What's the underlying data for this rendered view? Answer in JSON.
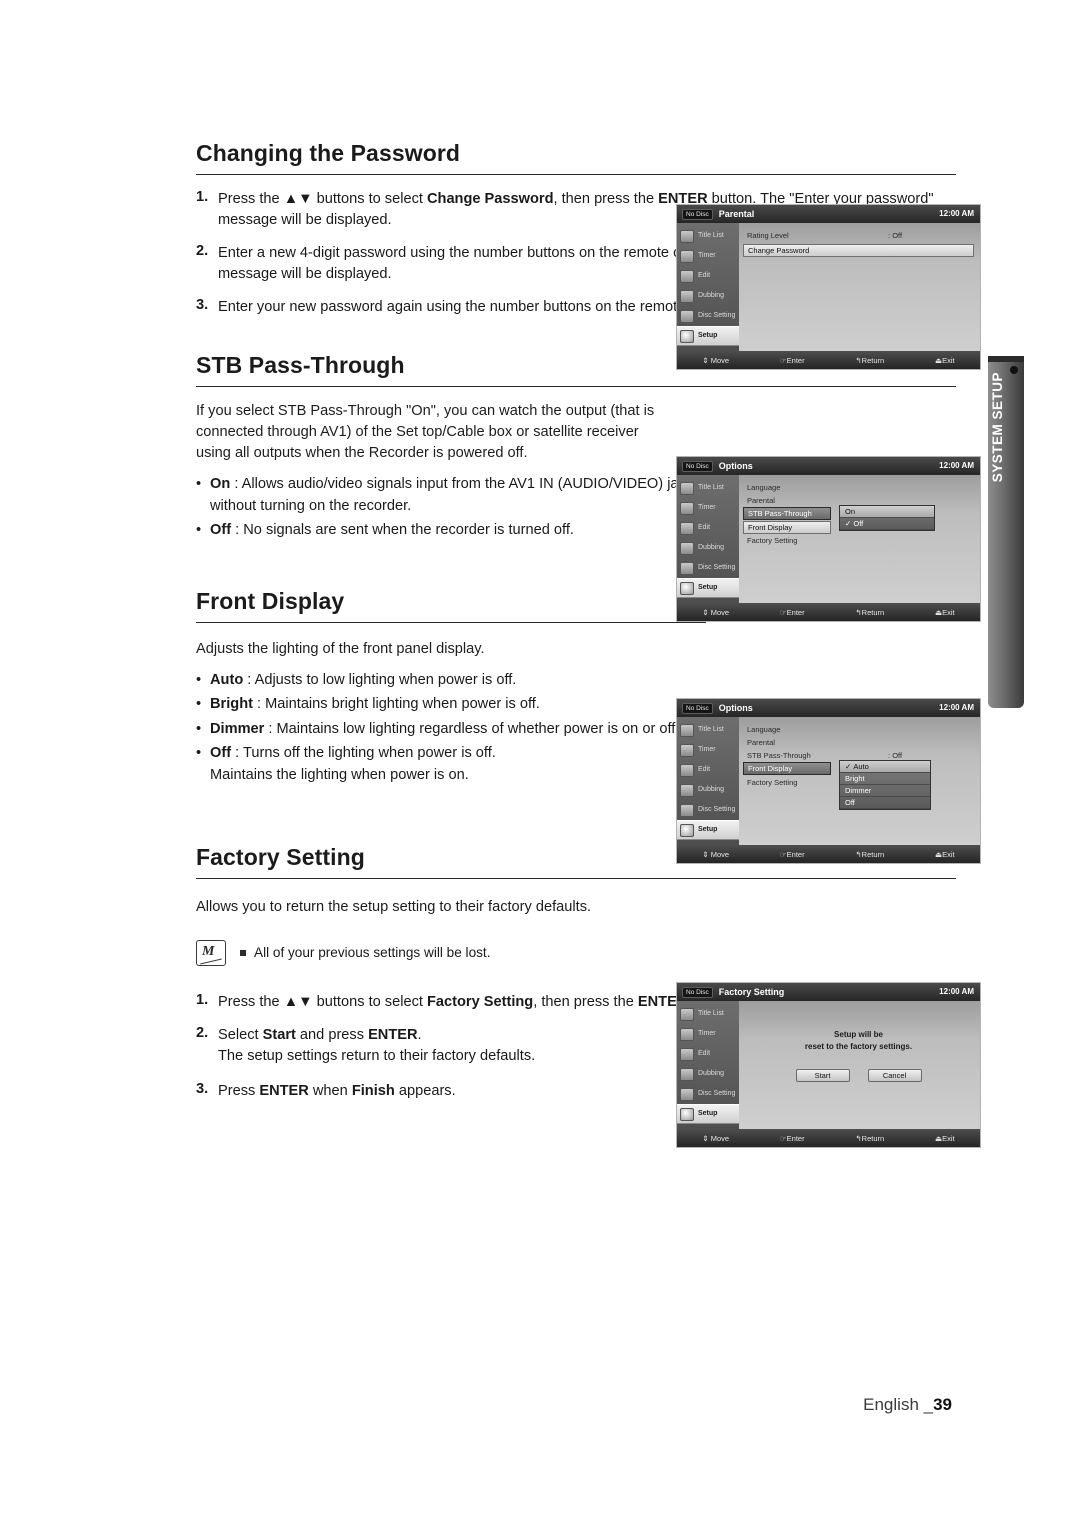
{
  "sidetab": {
    "label": "SYSTEM SETUP"
  },
  "footer": {
    "lang": "English _",
    "page": "39"
  },
  "sections": {
    "password": {
      "heading": "Changing the Password",
      "steps": [
        {
          "n": "1.",
          "html": "Press the ▲▼ buttons to select <b>Change Password</b>, then press the <b>ENTER</b> button.  The \"Enter your password\" message will be displayed."
        },
        {
          "n": "2.",
          "html": "Enter a new 4-digit password using the number buttons on the remote control. The “Confirm the password” message will be displayed."
        },
        {
          "n": "3.",
          "html": "Enter your new password again using the number buttons on the remote control."
        }
      ]
    },
    "stb": {
      "heading": "STB Pass-Through",
      "para": "If you select STB Pass-Through \"On\", you can watch the output (that is connected through AV1) of the Set top/Cable box or satellite receiver using all outputs when the Recorder is powered off.",
      "bullets": [
        {
          "html": "<b>On</b> : Allows audio/video signals input from the AV1 IN (AUDIO/VIDEO) jacks to pass through to all output jacks without turning on the recorder."
        },
        {
          "html": "<b>Off</b> : No signals are sent when the recorder is turned off."
        }
      ]
    },
    "front": {
      "heading": "Front Display",
      "para": "Adjusts the lighting of the front panel display.",
      "bullets": [
        {
          "html": "<b>Auto</b> : Adjusts to low lighting when power is off."
        },
        {
          "html": "<b>Bright</b> : Maintains bright lighting when power is off."
        },
        {
          "html": "<b>Dimmer</b> : Maintains low lighting regardless of whether power is on or off."
        },
        {
          "html": "<b>Off</b> : Turns off the lighting when power is off.<br>Maintains the lighting when power is on."
        }
      ]
    },
    "factory": {
      "heading": "Factory Setting",
      "para": "Allows you to return the setup setting to their factory defaults.",
      "note": "All of your previous settings will be lost.",
      "steps": [
        {
          "n": "1.",
          "html": "Press the ▲▼ buttons to select <b>Factory Setting</b>, then press the <b>ENTER</b> button."
        },
        {
          "n": "2.",
          "html": "Select <b>Start</b> and press <b>ENTER</b>.<br>The setup settings return to their factory defaults."
        },
        {
          "n": "3.",
          "html": "Press <b>ENTER</b> when <b>Finish</b> appears."
        }
      ]
    }
  },
  "osd_common": {
    "nodisc": "No Disc",
    "clock": "12:00 AM",
    "sidemenu": [
      "Title List",
      "Timer",
      "Edit",
      "Dubbing",
      "Disc Setting",
      "Setup"
    ],
    "footer": {
      "move": "Move",
      "enter": "Enter",
      "return": "Return",
      "exit": "Exit"
    }
  },
  "osd1": {
    "title": "Parental",
    "rows": [
      {
        "k": "Rating Level",
        "sep": ":",
        "v": "Off"
      }
    ],
    "highlight": "Change Password"
  },
  "osd2": {
    "title": "Options",
    "rows": [
      {
        "k": "Language"
      },
      {
        "k": "Parental"
      },
      {
        "k": "STB Pass-Through",
        "selected": true
      },
      {
        "k": "Front Display",
        "sep": ":",
        "v": "Off"
      },
      {
        "k": "Factory Setting"
      }
    ],
    "dropdown": {
      "items": [
        "On",
        "Off"
      ],
      "checked": "Off",
      "on_index": 0
    }
  },
  "osd3": {
    "title": "Options",
    "rows": [
      {
        "k": "Language"
      },
      {
        "k": "Parental"
      },
      {
        "k": "STB Pass-Through",
        "sep": ":",
        "v": "Off"
      },
      {
        "k": "Front Display",
        "selected": true
      },
      {
        "k": "Factory Setting"
      }
    ],
    "dropdown": {
      "items": [
        "Auto",
        "Bright",
        "Dimmer",
        "Off"
      ],
      "checked": "Auto"
    }
  },
  "osd4": {
    "title": "Factory Setting",
    "msg_line1": "Setup will be",
    "msg_line2": "reset to the factory settings.",
    "start": "Start",
    "cancel": "Cancel"
  }
}
